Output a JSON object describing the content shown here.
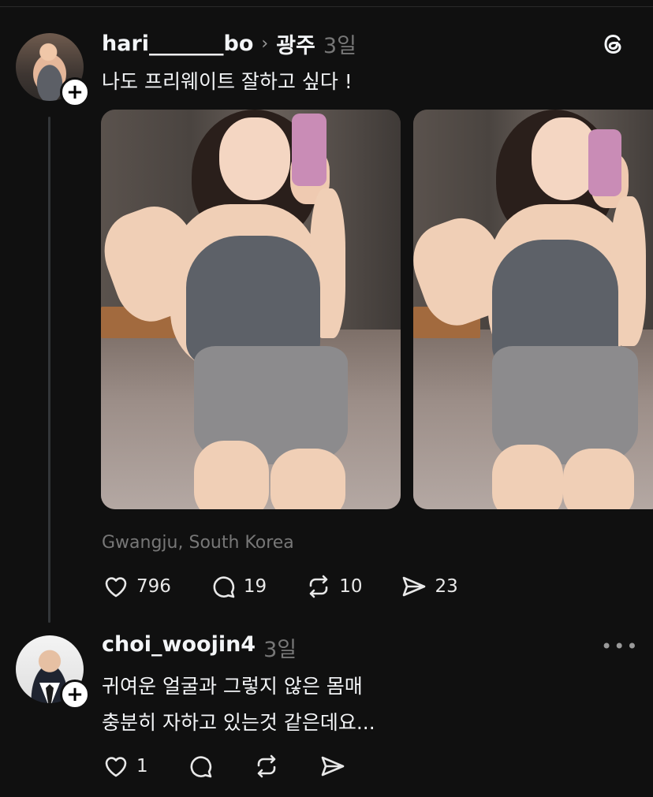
{
  "post": {
    "username": "hari_______bo",
    "location_tag": "광주",
    "time": "3일",
    "text": "나도 프리웨이트 잘하고 싶다 !",
    "location": "Gwangju, South Korea",
    "likes": "796",
    "replies": "19",
    "reposts": "10",
    "shares": "23"
  },
  "reply": {
    "username": "choi_woojin4",
    "time": "3일",
    "line1": "귀여운 얼굴과 그렇지 않은 몸매",
    "line2": "충분히 자하고 있는것 같은데요...",
    "likes": "1",
    "more": "•••"
  },
  "icons": {
    "like": "heart-icon",
    "reply": "comment-icon",
    "repost": "repost-icon",
    "share": "send-icon",
    "logo": "threads-logo-icon",
    "follow": "plus-icon",
    "chevron": "chevron-right-icon"
  }
}
